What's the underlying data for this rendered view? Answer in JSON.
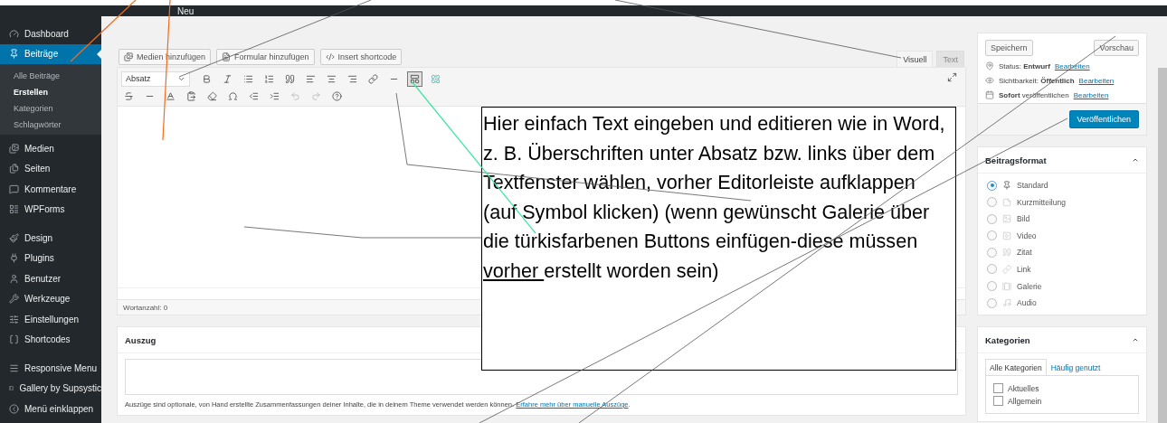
{
  "admin_bar": {
    "new_label": "Neu"
  },
  "sidebar": {
    "items": [
      {
        "label": "Dashboard",
        "selected": false
      },
      {
        "label": "Beiträge",
        "selected": true,
        "children": [
          {
            "label": "Alle Beiträge",
            "selected": false
          },
          {
            "label": "Erstellen",
            "selected": true
          },
          {
            "label": "Kategorien",
            "selected": false
          },
          {
            "label": "Schlagwörter",
            "selected": false
          }
        ]
      },
      {
        "label": "Medien",
        "selected": false
      },
      {
        "label": "Seiten",
        "selected": false
      },
      {
        "label": "Kommentare",
        "selected": false
      },
      {
        "label": "WPForms",
        "selected": false
      },
      {
        "label": "Design",
        "selected": false
      },
      {
        "label": "Plugins",
        "selected": false
      },
      {
        "label": "Benutzer",
        "selected": false
      },
      {
        "label": "Werkzeuge",
        "selected": false
      },
      {
        "label": "Einstellungen",
        "selected": false
      },
      {
        "label": "Shortcodes",
        "selected": false
      },
      {
        "label": "Responsive Menu",
        "selected": false
      },
      {
        "label": "Gallery by Supsystic",
        "selected": false
      },
      {
        "label": "Menü einklappen",
        "selected": false
      }
    ]
  },
  "media_buttons": [
    "Medien hinzufügen",
    "Formular hinzufügen",
    "Insert shortcode"
  ],
  "editor_tabs": [
    {
      "label": "Visuell",
      "selected": true
    },
    {
      "label": "Text",
      "selected": false
    }
  ],
  "toolbar": {
    "format": "Absatz",
    "kitchen_sink_active": true
  },
  "word_count": "Wortanzahl: 0",
  "excerpt": {
    "title": "Auszug",
    "help": "Auszüge sind optionale, von Hand erstellte Zusammenfassungen deiner Inhalte, die in deinem Theme verwendet werden können.",
    "link": "Erfahre mehr über manuelle Auszüge",
    "link_end": "."
  },
  "publish": {
    "save": "Speichern",
    "preview": "Vorschau",
    "rows": [
      {
        "text": "Status: **Entwurf**",
        "link": "Bearbeiten"
      },
      {
        "text": "Sichtbarkeit: **Öffentlich**",
        "link": "Bearbeiten"
      },
      {
        "text": "**Sofort** veröffentlichen",
        "link": "Bearbeiten"
      }
    ],
    "publish_button": "Veröffentlichen"
  },
  "post_format": {
    "title": "Beitragsformat",
    "options": [
      {
        "label": "Standard",
        "selected": true
      },
      {
        "label": "Kurzmitteilung",
        "selected": false
      },
      {
        "label": "Bild",
        "selected": false
      },
      {
        "label": "Video",
        "selected": false
      },
      {
        "label": "Zitat",
        "selected": false
      },
      {
        "label": "Link",
        "selected": false
      },
      {
        "label": "Galerie",
        "selected": false
      },
      {
        "label": "Audio",
        "selected": false
      }
    ]
  },
  "categories": {
    "title": "Kategorien",
    "tabs": [
      {
        "label": "Alle Kategorien",
        "selected": true
      },
      {
        "label": "Häufig genutzt",
        "selected": false
      }
    ],
    "items": [
      {
        "label": "Aktuelles",
        "checked": false
      },
      {
        "label": "Allgemein",
        "checked": false
      }
    ]
  },
  "annotation": {
    "text_before": "Hier einfach Text eingeben und editieren wie in Word, z. B. Überschriften unter Absatz bzw. links über dem Textfenster wählen, vorher Editorleiste aufklappen (auf Symbol klicken) (wenn gewünscht Galerie  über die türkisfarbenen Buttons einfügen-diese müssen ",
    "underlined": "vorher ",
    "text_after": "erstellt worden sein)"
  }
}
